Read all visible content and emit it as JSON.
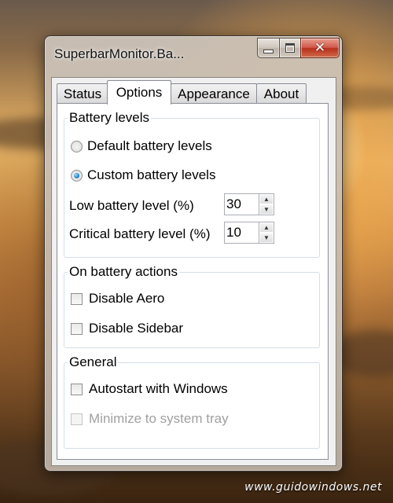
{
  "window": {
    "title": "SuperbarMonitor.Ba...",
    "close_symbol": "✕"
  },
  "tabs": [
    {
      "label": "Status",
      "active": false
    },
    {
      "label": "Options",
      "active": true
    },
    {
      "label": "Appearance",
      "active": false
    },
    {
      "label": "About",
      "active": false
    }
  ],
  "battery_levels": {
    "legend": "Battery levels",
    "default_option": {
      "label": "Default battery levels",
      "selected": false
    },
    "custom_option": {
      "label": "Custom battery levels",
      "selected": true
    },
    "low": {
      "label": "Low battery level (%)",
      "value": "30"
    },
    "critical": {
      "label": "Critical battery level (%)",
      "value": "10"
    }
  },
  "on_battery_actions": {
    "legend": "On battery actions",
    "disable_aero": {
      "label": "Disable Aero",
      "checked": false
    },
    "disable_sidebar": {
      "label": "Disable Sidebar",
      "checked": false
    }
  },
  "general": {
    "legend": "General",
    "autostart": {
      "label": "Autostart with Windows",
      "checked": false
    },
    "minimize": {
      "label": "Minimize to system tray",
      "checked": false,
      "enabled": false
    }
  },
  "watermark": "www.guidowindows.net",
  "icons": {
    "minimize": "minimize-icon",
    "maximize": "maximize-icon",
    "close": "close-icon",
    "spin_up": "chevron-up-icon",
    "spin_down": "chevron-down-icon"
  },
  "colors": {
    "close_button": "#d0584a",
    "radio_selected": "#2a8ad8",
    "group_border": "#d5dfe5",
    "disabled_text": "#a0a0a0"
  }
}
